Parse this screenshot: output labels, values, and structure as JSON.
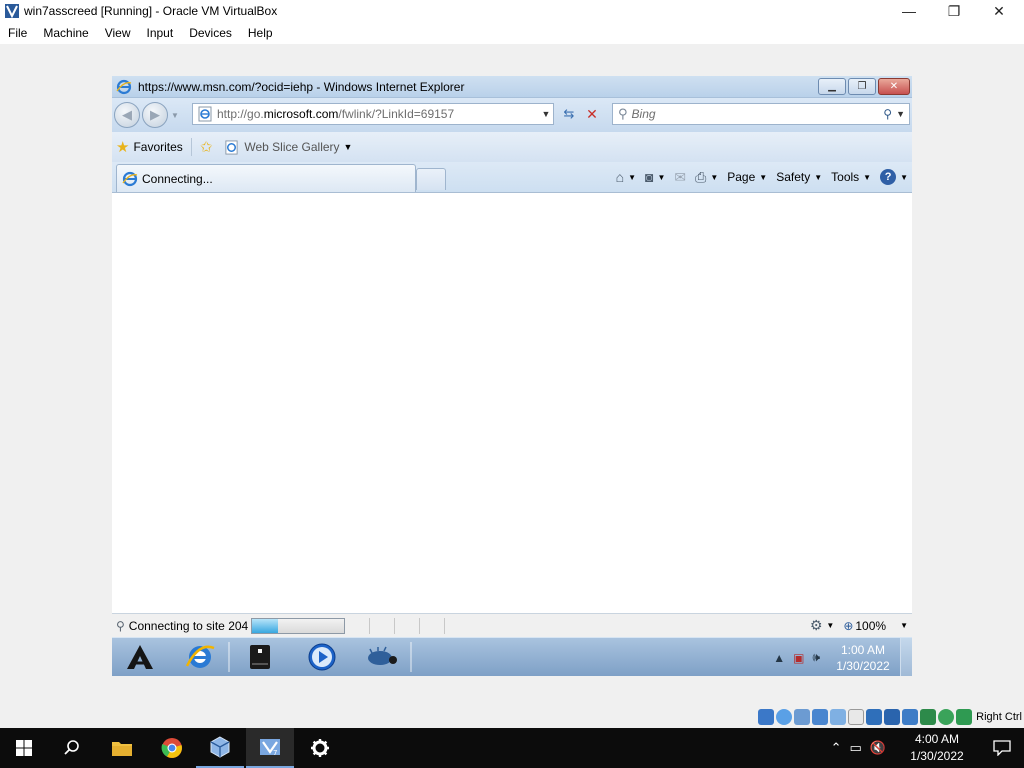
{
  "host_window": {
    "title": "win7asscreed [Running] - Oracle VM VirtualBox",
    "controls": {
      "minimize": "—",
      "maximize": "❐",
      "close": "✕"
    },
    "menu": [
      "File",
      "Machine",
      "View",
      "Input",
      "Devices",
      "Help"
    ],
    "status_icons": [
      "hard-disk-icon",
      "optical-drive-icon",
      "audio-icon",
      "network-icon",
      "usb-icon",
      "shared-folders-icon",
      "display-icon",
      "recording-icon",
      "vrde-icon",
      "cpu-icon",
      "guest-additions-icon",
      "mouse-integration-icon"
    ],
    "host_key": "Right Ctrl"
  },
  "ie": {
    "title": "https://www.msn.com/?ocid=iehp - Windows Internet Explorer",
    "address_prefix": "http://go.",
    "address_domain": "microsoft.com",
    "address_suffix": "/fwlink/?LinkId=69157",
    "search_placeholder": "Bing",
    "favorites_label": "Favorites",
    "web_slice_label": "Web Slice Gallery",
    "tab_label": "Connecting...",
    "commands": {
      "page": "Page",
      "safety": "Safety",
      "tools": "Tools"
    },
    "status_text": "Connecting to site 204",
    "progress": 0.28,
    "zoom": "100%"
  },
  "guest_taskbar": {
    "clock_time": "1:00 AM",
    "clock_date": "1/30/2022",
    "pinned": [
      "assassins-creed-icon",
      "internet-explorer-icon",
      "drive-icon",
      "media-player-icon",
      "network-bug-icon"
    ]
  },
  "host_taskbar": {
    "clock_time": "4:00 AM",
    "clock_date": "1/30/2022",
    "pinned": [
      "windows-start-icon",
      "search-icon",
      "file-explorer-icon",
      "chrome-icon",
      "virtualbox-icon",
      "virtualbox-vm-icon",
      "settings-icon"
    ]
  },
  "colors": {
    "ie_frame": "#c6d9ee",
    "guest_taskbar": "#7ea0c6",
    "host_taskbar": "#0c0c0c",
    "progress_fill": "#37a7e0",
    "stop_red": "#c8302a"
  }
}
